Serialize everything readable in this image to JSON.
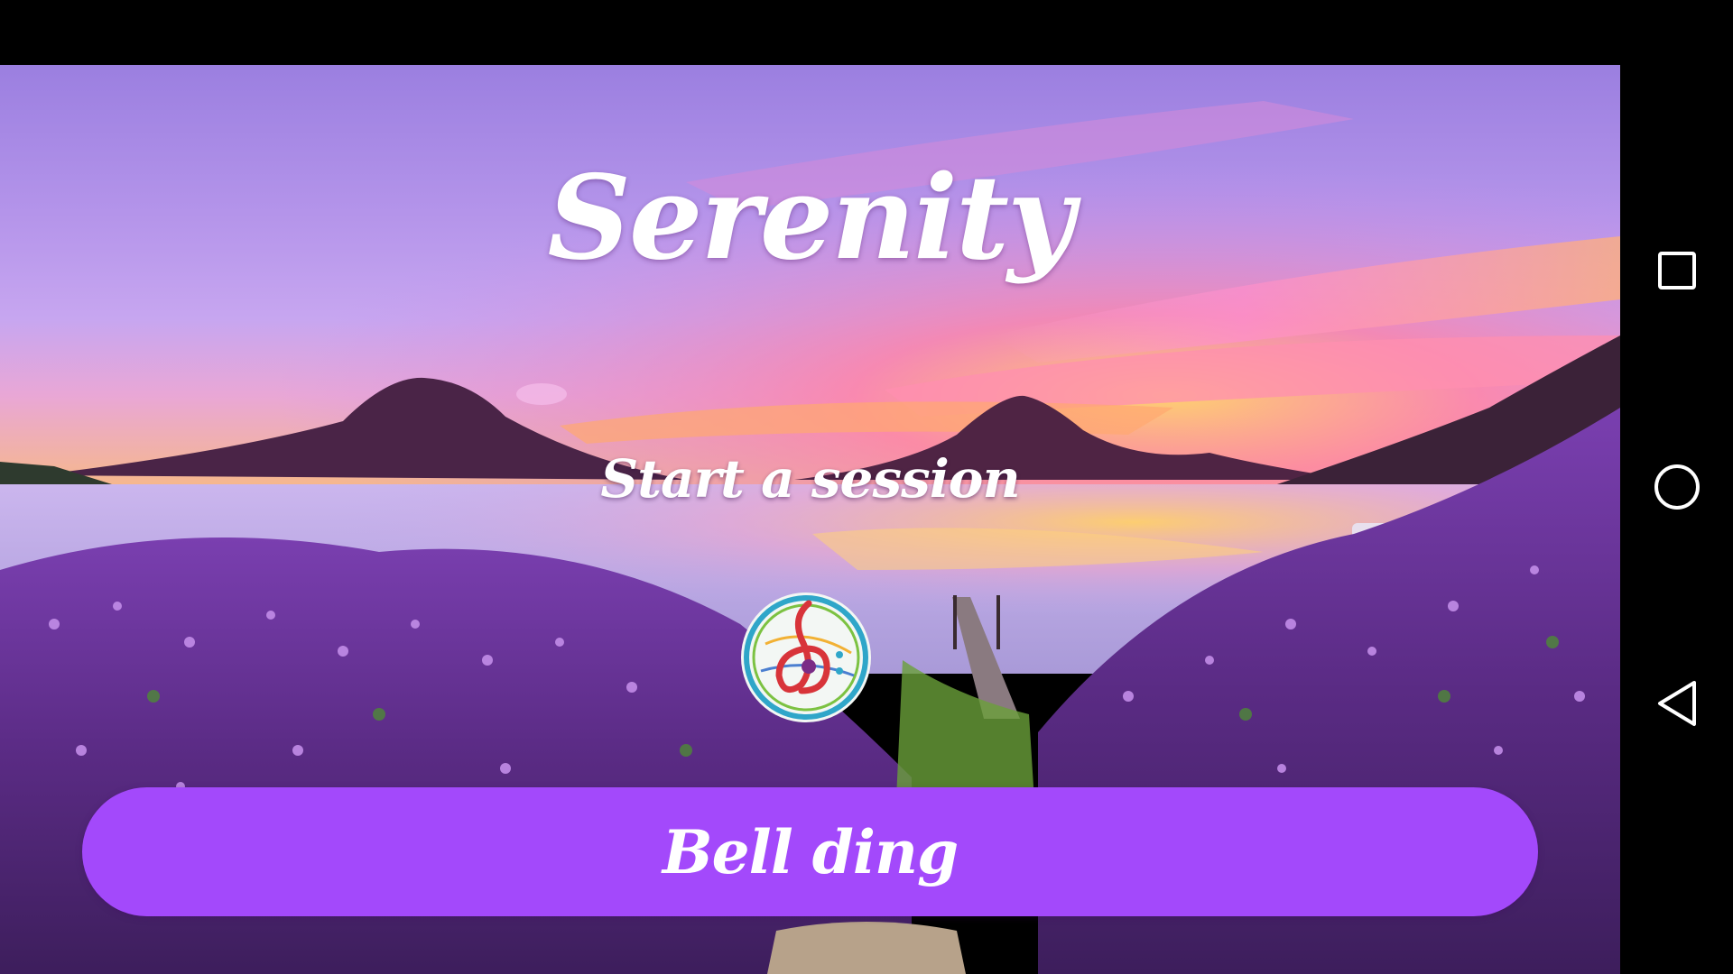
{
  "app": {
    "title": "Serenity",
    "subtitle": "Start a session"
  },
  "main": {
    "bell_button_label": "Bell ding"
  },
  "logo": {
    "icon": "music-clef-logo-icon"
  },
  "navigation": {
    "recents_icon": "square-recents-icon",
    "home_icon": "circle-home-icon",
    "back_icon": "triangle-back-icon"
  },
  "colors": {
    "button": "#a349fb",
    "text": "#ffffff",
    "system_bars": "#000000"
  }
}
